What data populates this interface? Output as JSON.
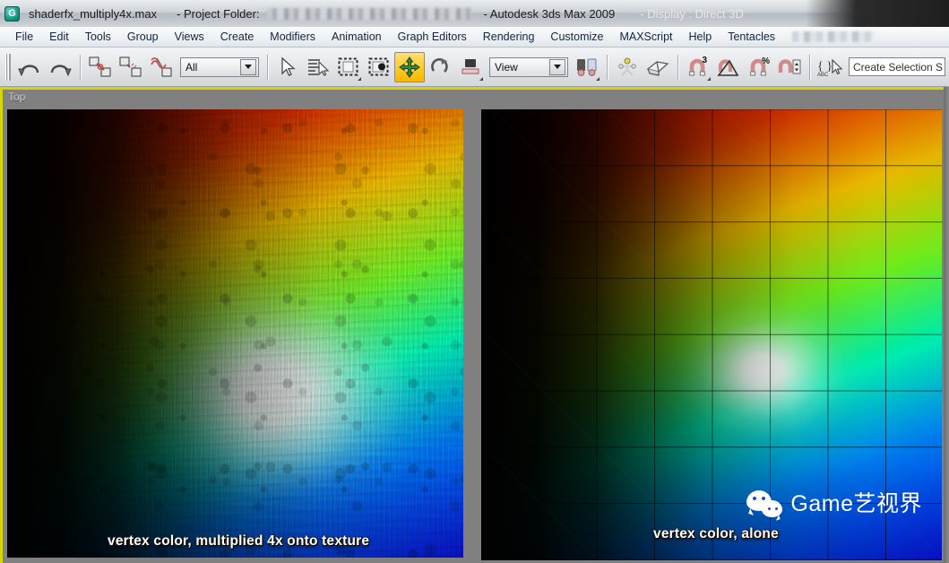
{
  "titlebar": {
    "app_icon": "3dsmax-app-icon",
    "document_name": "shaderfx_multiply4x.max",
    "project_label": "- Project Folder:",
    "product": "- Autodesk 3ds Max  2009",
    "display_mode": "- Display : Direct 3D"
  },
  "menubar": {
    "items": [
      {
        "label": "File"
      },
      {
        "label": "Edit"
      },
      {
        "label": "Tools"
      },
      {
        "label": "Group"
      },
      {
        "label": "Views"
      },
      {
        "label": "Create"
      },
      {
        "label": "Modifiers"
      },
      {
        "label": "Animation"
      },
      {
        "label": "Graph Editors"
      },
      {
        "label": "Rendering"
      },
      {
        "label": "Customize"
      },
      {
        "label": "MAXScript"
      },
      {
        "label": "Help"
      },
      {
        "label": "Tentacles"
      }
    ]
  },
  "toolbar": {
    "buttons": [
      {
        "name": "undo-icon",
        "glyph": "↶"
      },
      {
        "name": "redo-icon",
        "glyph": "↷"
      },
      {
        "name": "select-and-link-icon",
        "glyph": "⛓"
      },
      {
        "name": "unlink-selection-icon",
        "glyph": "✂"
      },
      {
        "name": "bind-to-space-warp-icon",
        "glyph": "≋"
      },
      {
        "name": "select-object-icon",
        "glyph": "➤"
      },
      {
        "name": "select-by-name-icon",
        "glyph": "☰"
      },
      {
        "name": "rectangular-selection-region-icon",
        "glyph": "▭"
      },
      {
        "name": "window-crossing-icon",
        "glyph": "◉"
      },
      {
        "name": "select-and-move-icon",
        "glyph": "✥"
      },
      {
        "name": "select-and-rotate-icon",
        "glyph": "↻"
      },
      {
        "name": "select-and-scale-icon",
        "glyph": "▰"
      },
      {
        "name": "mirror-icon",
        "glyph": "⧉"
      },
      {
        "name": "align-icon",
        "glyph": "✣"
      },
      {
        "name": "layer-manager-icon",
        "glyph": "◰"
      },
      {
        "name": "snaps-toggle-3d-icon",
        "glyph": "⌕"
      },
      {
        "name": "angle-snap-toggle-icon",
        "glyph": "∡"
      },
      {
        "name": "percent-snap-toggle-icon",
        "glyph": "⌕"
      },
      {
        "name": "spinner-snap-toggle-icon",
        "glyph": "⌕"
      },
      {
        "name": "edit-named-selection-sets-icon",
        "glyph": "{ }"
      }
    ],
    "selection_filter": {
      "label": "All",
      "name": "selection-filter-combo"
    },
    "reference_coordinate_system": {
      "label": "View",
      "name": "coordinate-system-combo"
    },
    "named_selection_set": {
      "value": "",
      "placeholder": "Create Selection S"
    },
    "snap_superscripts": {
      "snap3": "3",
      "percent": "%"
    }
  },
  "viewport": {
    "label": "Top",
    "active_border_color": "#d8d400",
    "background_color": "#808080",
    "panels": [
      {
        "name": "viewport-panel-left",
        "caption": "vertex color, multiplied 4x onto texture",
        "description": "textured concrete plane with vertex color multiplied 4x",
        "has_grid": false
      },
      {
        "name": "viewport-panel-right",
        "caption": "vertex color, alone",
        "description": "flat plane showing vertex colors only on wireframe grid",
        "has_grid": true
      }
    ]
  },
  "watermark": {
    "icon": "wechat-icon",
    "text": "Game艺视界",
    "color": "#ffffff"
  }
}
